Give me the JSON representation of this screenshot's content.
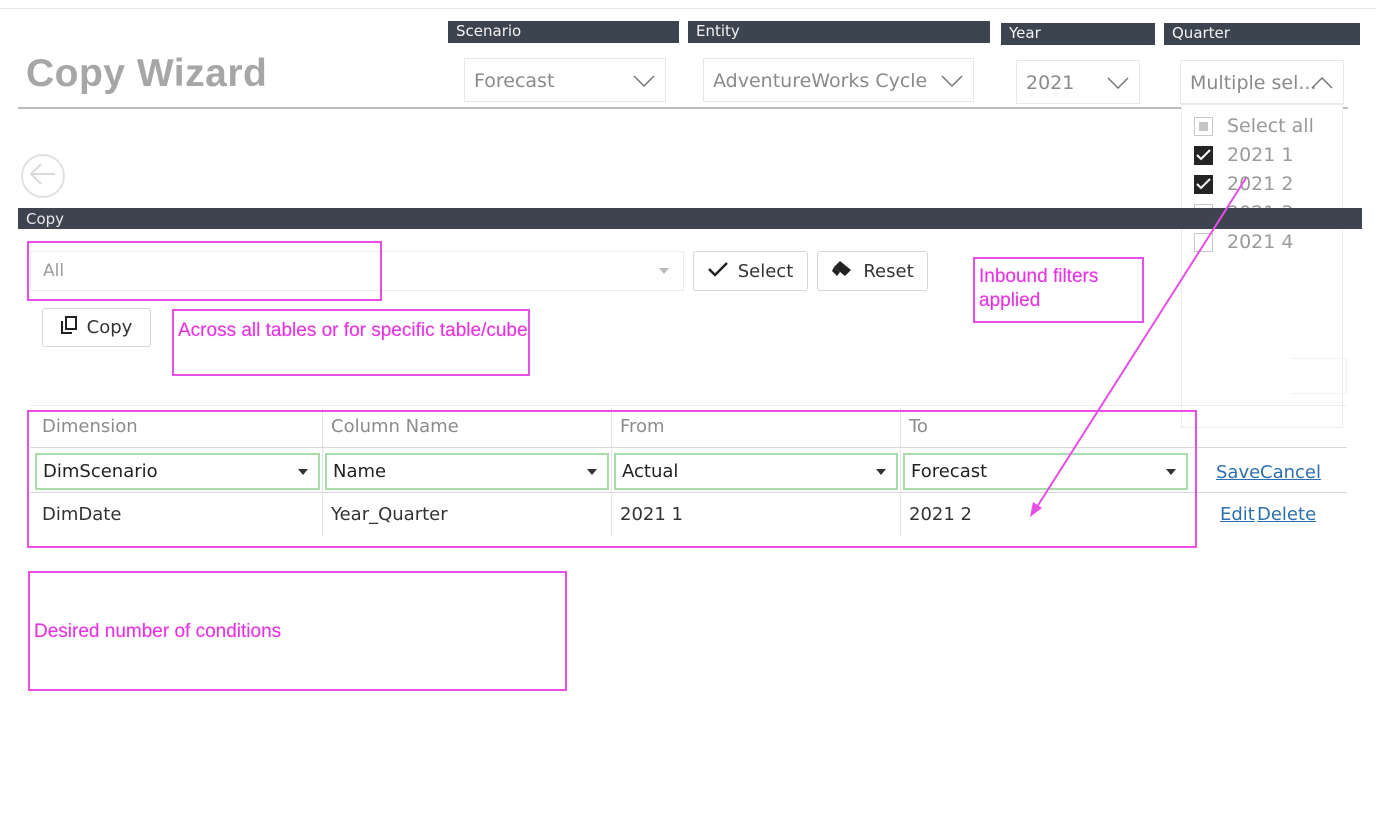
{
  "title": "Copy Wizard",
  "slicers": {
    "scenario": {
      "label": "Scenario",
      "value": "Forecast"
    },
    "entity": {
      "label": "Entity",
      "value": "AdventureWorks Cycle"
    },
    "year": {
      "label": "Year",
      "value": "2021"
    },
    "quarter": {
      "label": "Quarter",
      "value": "Multiple sel...",
      "options": [
        {
          "label": "Select all",
          "state": "partial"
        },
        {
          "label": "2021 1",
          "state": "checked"
        },
        {
          "label": "2021 2",
          "state": "checked"
        },
        {
          "label": "2021 3",
          "state": "unchecked"
        },
        {
          "label": "2021 4",
          "state": "unchecked"
        }
      ]
    }
  },
  "icons": {
    "back": "back-arrow-icon",
    "check": "check-icon",
    "eraser": "eraser-icon",
    "copy": "copy-icon",
    "chevron": "chevron-down-icon",
    "caret": "caret-down-icon"
  },
  "section_label": "Copy",
  "table_select": {
    "value": "All"
  },
  "buttons": {
    "select": "Select",
    "reset": "Reset",
    "copy": "Copy"
  },
  "grid": {
    "headers": [
      "Dimension",
      "Column Name",
      "From",
      "To"
    ],
    "edit_row": {
      "dimension": "DimScenario",
      "column": "Name",
      "from": "Actual",
      "to": "Forecast",
      "save": "Save",
      "cancel": "Cancel"
    },
    "rows": [
      {
        "dimension": "DimDate",
        "column": "Year_Quarter",
        "from": "2021 1",
        "to": "2021 2",
        "edit": "Edit",
        "delete": "Delete"
      }
    ]
  },
  "annotations": {
    "inbound": "Inbound filters applied",
    "across": "Across all tables or for specific table/cube",
    "desired": "Desired number of conditions"
  },
  "colors": {
    "annotation": "#e64ee6",
    "header_bar": "#3c4450",
    "link": "#2e6fad",
    "edit_row_border": "#aadcaa"
  }
}
